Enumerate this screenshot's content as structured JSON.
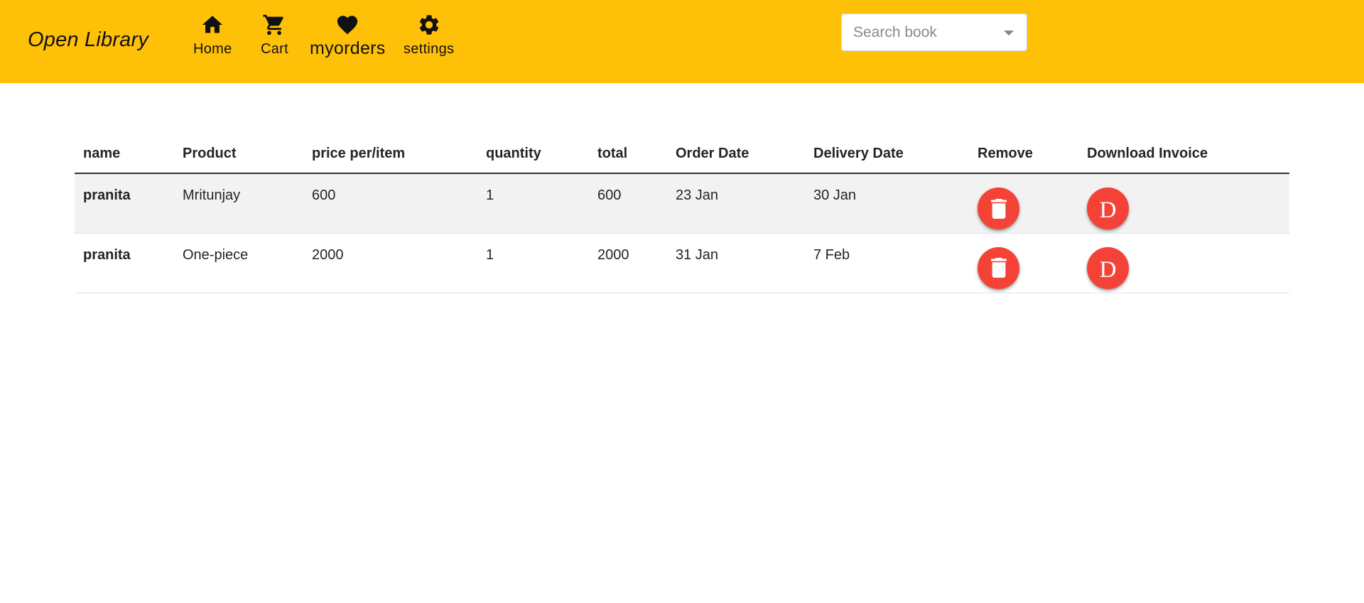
{
  "brand": "Open Library",
  "nav": {
    "home": {
      "label": "Home",
      "icon": "home-icon"
    },
    "cart": {
      "label": "Cart",
      "icon": "cart-icon"
    },
    "myorders": {
      "label": "myorders",
      "icon": "heart-icon"
    },
    "settings": {
      "label": "settings",
      "icon": "gear-icon"
    }
  },
  "search": {
    "placeholder": "Search book"
  },
  "colors": {
    "navbar": "#ffc107",
    "action_button": "#f44336"
  },
  "table": {
    "headers": [
      "name",
      "Product",
      "price per/item",
      "quantity",
      "total",
      "Order Date",
      "Delivery Date",
      "Remove",
      "Download Invoice"
    ],
    "rows": [
      {
        "name": "pranita",
        "product": "Mritunjay",
        "price": "600",
        "quantity": "1",
        "total": "600",
        "order_date": "23 Jan",
        "delivery_date": "30 Jan",
        "remove_icon": "trash-icon",
        "invoice_label": "D"
      },
      {
        "name": "pranita",
        "product": "One-piece",
        "price": "2000",
        "quantity": "1",
        "total": "2000",
        "order_date": "31 Jan",
        "delivery_date": "7 Feb",
        "remove_icon": "trash-icon",
        "invoice_label": "D"
      }
    ]
  }
}
